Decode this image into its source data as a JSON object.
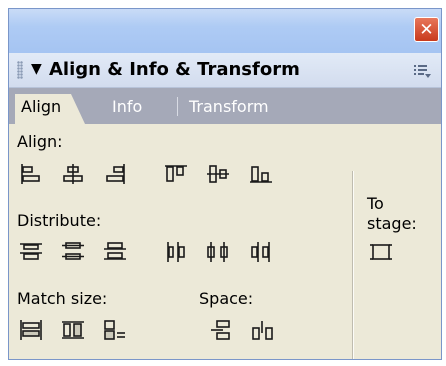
{
  "window": {
    "close_glyph": "✕"
  },
  "panel": {
    "collapse_arrow": "▼",
    "title": "Align & Info & Transform",
    "options_icon": "panel-options-icon"
  },
  "tabs": [
    {
      "label": "Align",
      "active": true
    },
    {
      "label": "Info",
      "active": false
    },
    {
      "label": "Transform",
      "active": false
    }
  ],
  "sections": {
    "align": "Align:",
    "distribute": "Distribute:",
    "match_size": "Match size:",
    "space": "Space:",
    "to_stage_line1": "To",
    "to_stage_line2": "stage:"
  },
  "icons": {
    "align": [
      "align-left-edge-icon",
      "align-horizontal-center-icon",
      "align-right-edge-icon",
      "align-top-edge-icon",
      "align-vertical-center-icon",
      "align-bottom-edge-icon"
    ],
    "distribute": [
      "distribute-top-edge-icon",
      "distribute-vertical-center-icon",
      "distribute-bottom-edge-icon",
      "distribute-left-edge-icon",
      "distribute-horizontal-center-icon",
      "distribute-right-edge-icon"
    ],
    "match_size": [
      "match-width-icon",
      "match-height-icon",
      "match-width-and-height-icon"
    ],
    "space": [
      "space-evenly-vertically-icon",
      "space-evenly-horizontally-icon"
    ],
    "to_stage": "to-stage-icon"
  },
  "colors": {
    "panel_bg": "#ece9d8",
    "titlebar": "#a5c4f2",
    "tab_strip": "#a5a9b8",
    "icon_stroke": "#1a1a1a",
    "close_button": "#d2472a"
  }
}
